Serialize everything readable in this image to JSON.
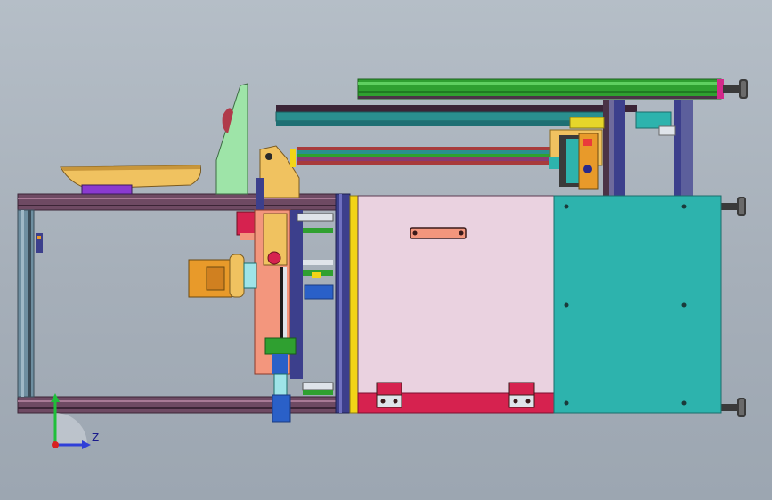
{
  "viewport": {
    "background_top": "#b5bec7",
    "background_bottom": "#9ca6b1"
  },
  "triad": {
    "axis_z_label": "Z",
    "y_axis_color": "#1fbf3a",
    "z_axis_color": "#2f3fd8",
    "x_axis_color": "#d82020"
  },
  "colors": {
    "frame_rail": "#6e4a63",
    "frame_edge": "#3b2436",
    "green_beam": "#2fa030",
    "teal_beam": "#2a8f8f",
    "pink_panel": "#ead2e0",
    "teal_panel": "#2db3ad",
    "red_base": "#d6224f",
    "yellow_strip": "#f2d417",
    "salmon_plate": "#f3967d",
    "tray_gold": "#f0c260",
    "mint_plate": "#9ee4a8",
    "navy_column": "#3c3f8c",
    "orange_block": "#e89a2a"
  }
}
